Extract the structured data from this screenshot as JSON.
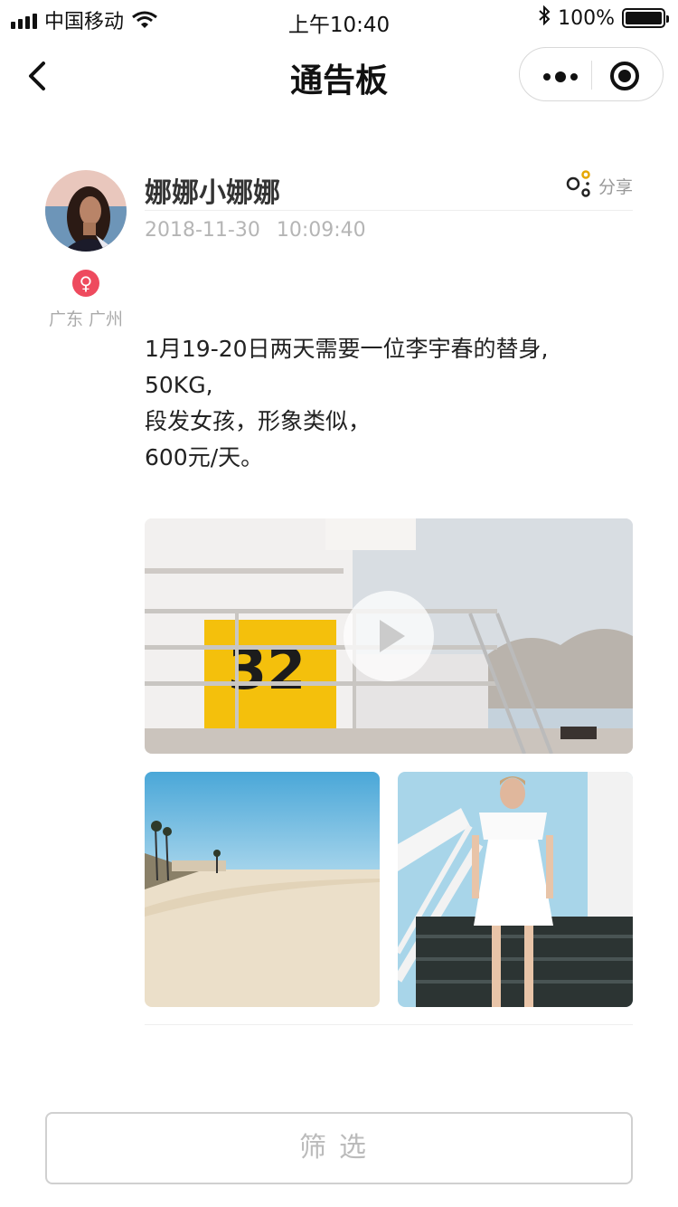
{
  "status_bar": {
    "carrier": "中国移动",
    "time": "上午10:40",
    "battery_pct": "100%",
    "battery_level": 1.0,
    "icons": [
      "signal-icon",
      "wifi-icon",
      "bluetooth-icon",
      "battery-icon"
    ]
  },
  "nav": {
    "title": "通告板",
    "icons": [
      "back-icon",
      "more-icon",
      "target-icon"
    ]
  },
  "post": {
    "username": "娜娜小娜娜",
    "date": "2018-11-30",
    "time": "10:09:40",
    "location": "广东 广州",
    "gender_icon": "female-icon",
    "share_label": "分享",
    "text_lines": [
      "1月19-20日两天需要一位李宇春的替身,",
      "50KG,",
      "段发女孩，形象类似，",
      "600元/天。"
    ],
    "media": [
      {
        "type": "video",
        "name": "lifeguard-tower-video"
      },
      {
        "type": "image",
        "name": "beach-photo"
      },
      {
        "type": "image",
        "name": "white-dress-photo"
      }
    ]
  },
  "filter": {
    "label": "筛选"
  },
  "colors": {
    "gender_badge": "#ee4a5e",
    "muted_text": "#b5b5b5",
    "title_text": "#111111"
  }
}
